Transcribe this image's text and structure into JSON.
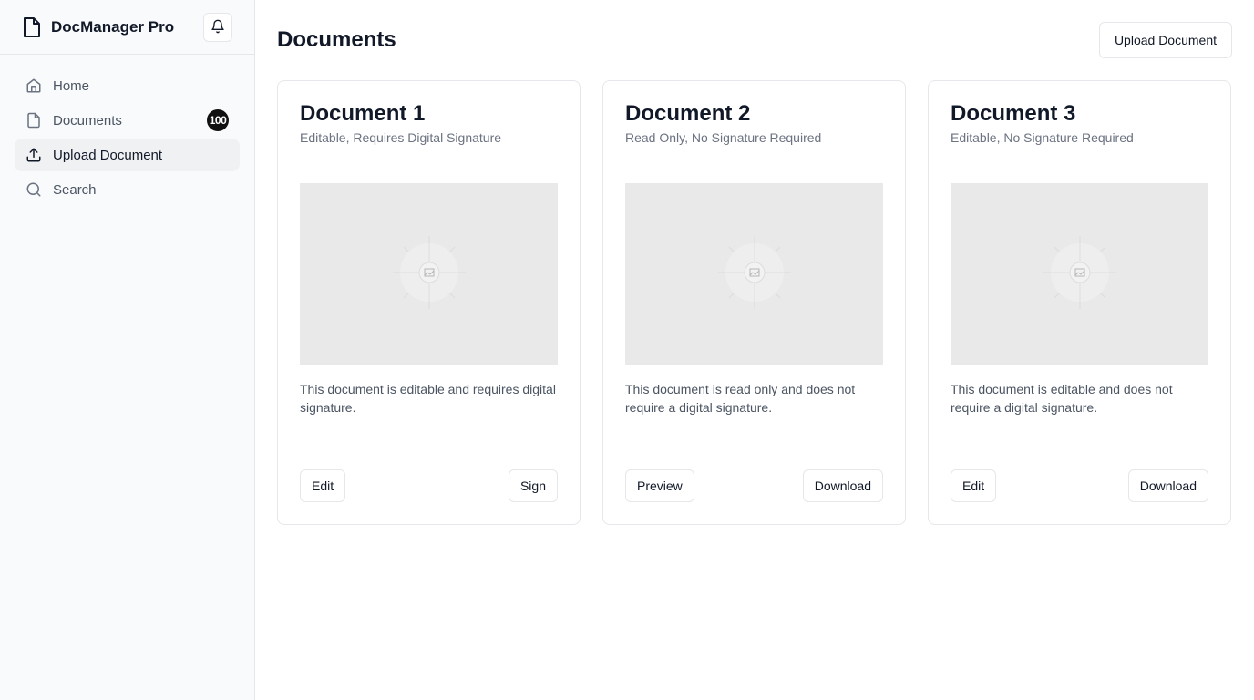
{
  "app": {
    "brand_name": "DocManager Pro",
    "brand_icon": "file-icon",
    "notification_icon": "bell-icon"
  },
  "sidebar": {
    "items": [
      {
        "label": "Home",
        "icon": "home-icon",
        "active": false
      },
      {
        "label": "Documents",
        "icon": "file-icon",
        "active": false,
        "badge": "100"
      },
      {
        "label": "Upload Document",
        "icon": "upload-icon",
        "active": true
      },
      {
        "label": "Search",
        "icon": "search-icon",
        "active": false
      }
    ]
  },
  "main": {
    "title": "Documents",
    "upload_button": "Upload Document",
    "cards": [
      {
        "title": "Document 1",
        "subtitle": "Editable, Requires Digital Signature",
        "description": "This document is editable and requires digital signature.",
        "actions": [
          "Edit",
          "Sign"
        ]
      },
      {
        "title": "Document 2",
        "subtitle": "Read Only, No Signature Required",
        "description": "This document is read only and does not require a digital signature.",
        "actions": [
          "Preview",
          "Download"
        ]
      },
      {
        "title": "Document 3",
        "subtitle": "Editable, No Signature Required",
        "description": "This document is editable and does not require a digital signature.",
        "actions": [
          "Edit",
          "Download"
        ]
      }
    ]
  },
  "colors": {
    "accent": "#111111",
    "sidebar_bg": "#f9fafb",
    "active_bg": "#f0f1f3",
    "placeholder_bg": "#e9e9e9"
  }
}
